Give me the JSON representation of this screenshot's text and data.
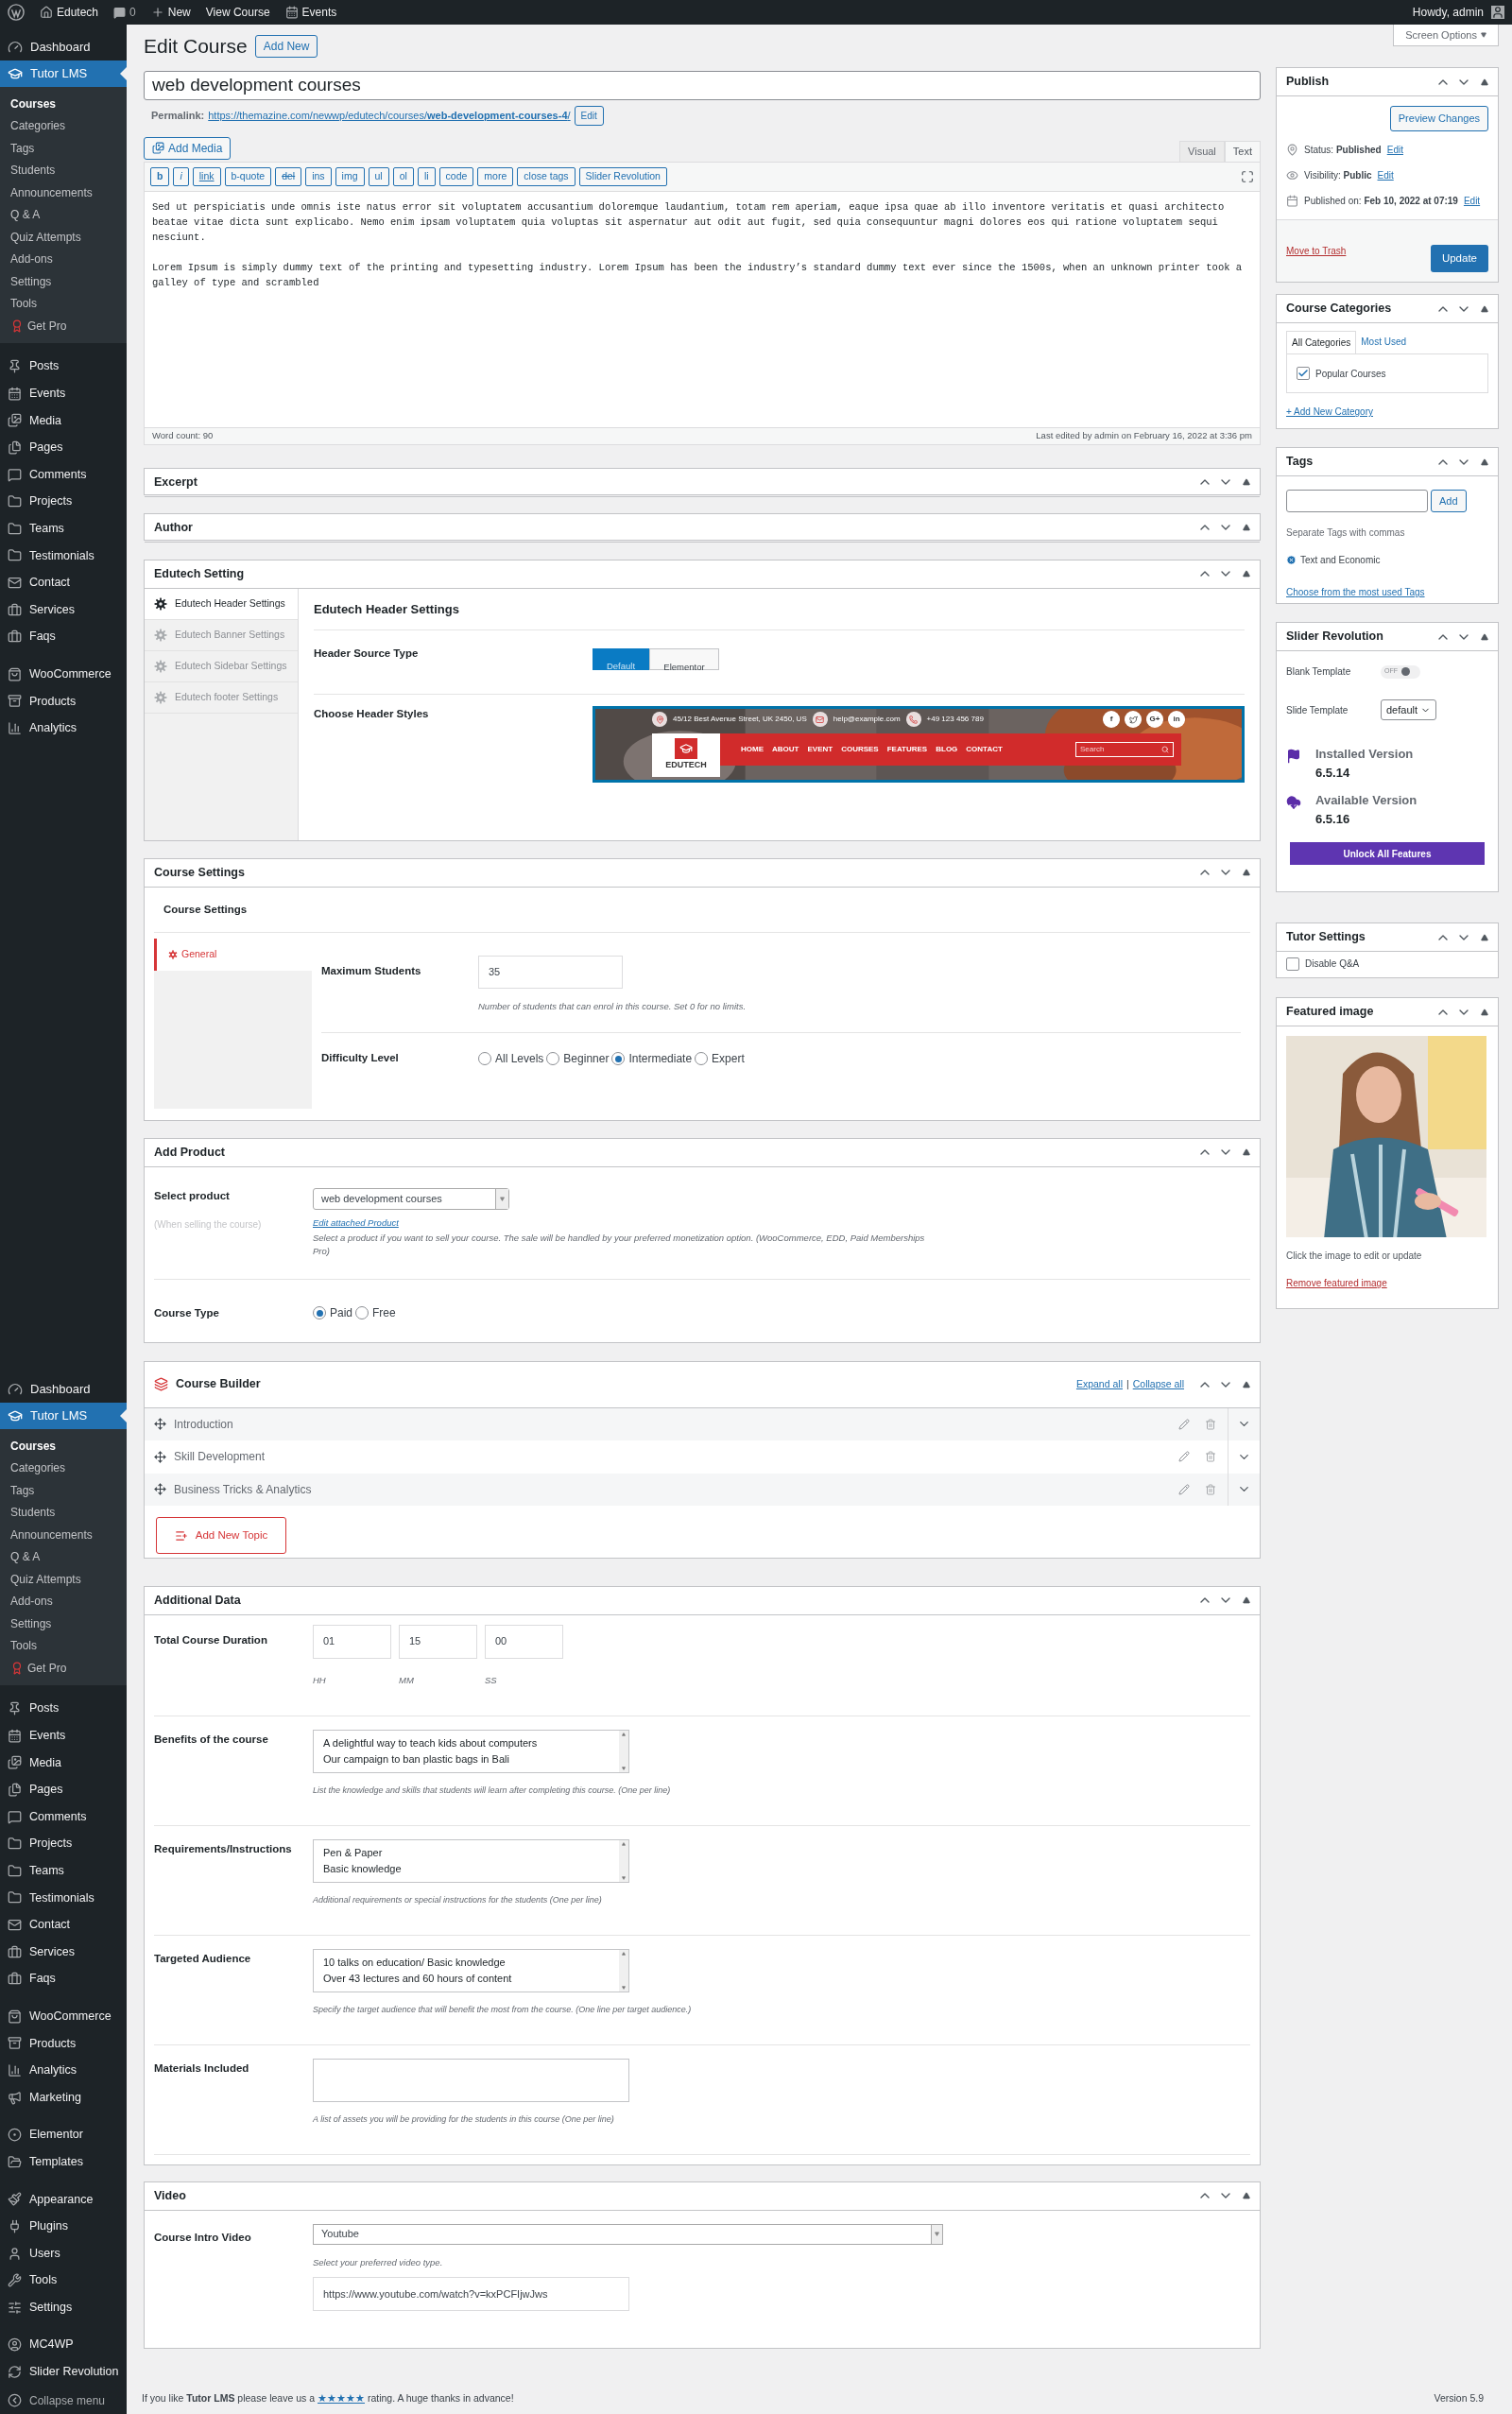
{
  "top_bar": {
    "site": "Edutech",
    "comments": "0",
    "new": "New",
    "view": "View Course",
    "events": "Events",
    "greeting": "Howdy, admin"
  },
  "admin_menus": [
    {
      "heads": [
        {
          "label": "Dashboard",
          "selected": false
        },
        {
          "label": "Tutor LMS",
          "selected": true
        }
      ],
      "submenu": [
        {
          "label": "Courses",
          "current": true,
          "kind": "link"
        },
        {
          "label": "Categories",
          "current": false,
          "kind": "link"
        },
        {
          "label": "Tags",
          "current": false,
          "kind": "link"
        },
        {
          "label": "Students",
          "current": false,
          "kind": "link"
        },
        {
          "label": "Announcements",
          "current": false,
          "kind": "link"
        },
        {
          "label": "Q & A",
          "current": false,
          "kind": "link"
        },
        {
          "label": "Quiz Attempts",
          "current": false,
          "kind": "link"
        },
        {
          "label": "Add-ons",
          "current": false,
          "kind": "link"
        },
        {
          "label": "Settings",
          "current": false,
          "kind": "link"
        },
        {
          "label": "Tools",
          "current": false,
          "kind": "link"
        },
        {
          "label": "Get Pro",
          "current": false,
          "kind": "pro"
        }
      ],
      "groups": [
        [
          "Posts",
          "Events",
          "Media",
          "Pages",
          "Comments",
          "Projects",
          "Teams",
          "Testimonials",
          "Contact",
          "Services",
          "Faqs"
        ],
        [
          "WooCommerce",
          "Products",
          "Analytics"
        ]
      ]
    },
    {
      "heads": [
        {
          "label": "Dashboard",
          "selected": false
        },
        {
          "label": "Tutor LMS",
          "selected": true
        }
      ],
      "submenu": [
        {
          "label": "Courses",
          "current": true,
          "kind": "link"
        },
        {
          "label": "Categories",
          "current": false,
          "kind": "link"
        },
        {
          "label": "Tags",
          "current": false,
          "kind": "link"
        },
        {
          "label": "Students",
          "current": false,
          "kind": "link"
        },
        {
          "label": "Announcements",
          "current": false,
          "kind": "link"
        },
        {
          "label": "Q & A",
          "current": false,
          "kind": "link"
        },
        {
          "label": "Quiz Attempts",
          "current": false,
          "kind": "link"
        },
        {
          "label": "Add-ons",
          "current": false,
          "kind": "link"
        },
        {
          "label": "Settings",
          "current": false,
          "kind": "link"
        },
        {
          "label": "Tools",
          "current": false,
          "kind": "link"
        },
        {
          "label": "Get Pro",
          "current": false,
          "kind": "pro"
        }
      ],
      "groups": [
        [
          "Posts",
          "Events",
          "Media",
          "Pages",
          "Comments",
          "Projects",
          "Teams",
          "Testimonials",
          "Contact",
          "Services",
          "Faqs"
        ],
        [
          "WooCommerce",
          "Products",
          "Analytics",
          "Marketing"
        ],
        [
          "Elementor",
          "Templates"
        ],
        [
          "Appearance",
          "Plugins",
          "Users",
          "Tools",
          "Settings"
        ],
        [
          "MC4WP",
          "Slider Revolution"
        ]
      ],
      "collapse": "Collapse menu"
    }
  ],
  "screen_options": "Screen Options",
  "page": {
    "title": "Edit Course",
    "add_new": "Add New"
  },
  "post_title": "web development courses",
  "permalink": {
    "label": "Permalink:",
    "url": "https://themazine.com/newwp/edutech/courses/**web-development-courses-4**/",
    "edit": "Edit"
  },
  "editor": {
    "add_media": "Add Media",
    "tabs": [
      {
        "label": "Visual",
        "selected": false
      },
      {
        "label": "Text",
        "selected": true
      }
    ],
    "buttons": [
      {
        "label": "b",
        "kind": "bold"
      },
      {
        "label": "i",
        "kind": "italic"
      },
      {
        "label": "link",
        "kind": "link"
      },
      {
        "label": "b-quote",
        "kind": "plain"
      },
      {
        "label": "del",
        "kind": "strike"
      },
      {
        "label": "ins",
        "kind": "plain"
      },
      {
        "label": "img",
        "kind": "plain"
      },
      {
        "label": "ul",
        "kind": "plain"
      },
      {
        "label": "ol",
        "kind": "plain"
      },
      {
        "label": "li",
        "kind": "plain"
      },
      {
        "label": "code",
        "kind": "plain"
      },
      {
        "label": "more",
        "kind": "plain"
      },
      {
        "label": "close tags",
        "kind": "plain"
      },
      {
        "label": "Slider Revolution",
        "kind": "plain"
      }
    ],
    "paragraphs": [
      "Sed ut perspiciatis unde omnis iste natus error sit voluptatem accusantium doloremque laudantium, totam rem aperiam, eaque ipsa quae ab illo inventore veritatis et quasi architecto beatae vitae dicta sunt explicabo. Nemo enim ipsam voluptatem quia voluptas sit aspernatur aut odit aut fugit, sed quia consequuntur magni dolores eos qui ratione voluptatem sequi nesciunt.",
      "Lorem Ipsum is simply dummy text of the printing and typesetting industry. Lorem Ipsum has been the industry’s standard dummy text ever since the 1500s, when an unknown printer took a galley of type and scrambled"
    ],
    "word_count": "Word count: 90",
    "last_edited": "Last edited by admin on February 16, 2022 at 3:36 pm"
  },
  "collapsed_boxes": [
    {
      "title": "Excerpt"
    },
    {
      "title": "Author"
    }
  ],
  "edutech_setting": {
    "title": "Edutech Setting",
    "tabs": [
      {
        "label": "Edutech Header Settings",
        "selected": true
      },
      {
        "label": "Edutech Banner Settings",
        "selected": false
      },
      {
        "label": "Edutech Sidebar Settings",
        "selected": false
      },
      {
        "label": "Edutech footer Settings",
        "selected": false
      }
    ],
    "heading": "Edutech Header Settings",
    "source_type": {
      "label": "Header Source Type",
      "options": [
        {
          "label": "Default",
          "selected": true
        },
        {
          "label": "Elementor",
          "selected": false
        }
      ]
    },
    "header_styles": {
      "label": "Choose Header Styles",
      "address": "45/12 Best Avenue Street, UK 2450, US",
      "email": "help@example.com",
      "phone": "+49 123 456 789",
      "socials": [
        "f",
        "G+",
        "in"
      ],
      "logo": "EDUTECH",
      "nav": [
        "HOME",
        "ABOUT",
        "EVENT",
        "COURSES",
        "FEATURES",
        "BLOG",
        "CONTACT"
      ],
      "search_placeholder": "Search"
    }
  },
  "course_settings": {
    "title": "Course Settings",
    "heading": "Course Settings",
    "tabs": [
      {
        "label": "General",
        "selected": true
      }
    ],
    "max_students": {
      "label": "Maximum Students",
      "value": "35",
      "help": "Number of students that can enrol in this course. Set 0 for no limits."
    },
    "difficulty": {
      "label": "Difficulty Level",
      "options": [
        {
          "label": "All Levels",
          "selected": false
        },
        {
          "label": "Beginner",
          "selected": false
        },
        {
          "label": "Intermediate",
          "selected": true
        },
        {
          "label": "Expert",
          "selected": false
        }
      ]
    }
  },
  "add_product": {
    "title": "Add Product",
    "select_label": "Select product",
    "select_note": "(When selling the course)",
    "select_value": "web development courses",
    "edit_link": "Edit attached Product",
    "help": "Select a product if you want to sell your course. The sale will be handled by your preferred monetization option. (WooCommerce, EDD, Paid Memberships Pro)",
    "course_type": {
      "label": "Course Type",
      "options": [
        {
          "label": "Paid",
          "selected": true
        },
        {
          "label": "Free",
          "selected": false
        }
      ]
    }
  },
  "course_builder": {
    "title": "Course Builder",
    "expand_all": "Expand all",
    "separator": "|",
    "collapse_all": "Collapse all",
    "topics": [
      {
        "title": "Introduction"
      },
      {
        "title": "Skill Development"
      },
      {
        "title": "Business Tricks & Analytics"
      }
    ],
    "add_topic": "Add New Topic"
  },
  "additional_data": {
    "title": "Additional Data",
    "duration": {
      "label": "Total Course Duration",
      "fields": [
        {
          "value": "01",
          "unit": "HH"
        },
        {
          "value": "15",
          "unit": "MM"
        },
        {
          "value": "00",
          "unit": "SS"
        }
      ]
    },
    "textareas": [
      {
        "label": "Benefits of the course",
        "lines": [
          "A delightful way to teach kids about computers",
          "Our campaign to ban plastic bags in Bali"
        ],
        "help": "List the knowledge and skills that students will learn after completing this course. (One per line)"
      },
      {
        "label": "Requirements/Instructions",
        "lines": [
          "Pen & Paper",
          "Basic knowledge"
        ],
        "help": "Additional requirements or special instructions for the students (One per line)"
      },
      {
        "label": "Targeted Audience",
        "lines": [
          "10 talks on education/ Basic knowledge",
          "Over 43 lectures and 60 hours of content"
        ],
        "help": "Specify the target audience that will benefit the most from the course. (One line per target audience.)"
      },
      {
        "label": "Materials Included",
        "help": "A list of assets you will be providing for the students in this course (One per line)"
      }
    ]
  },
  "video": {
    "title": "Video",
    "label": "Course Intro Video",
    "select_value": "Youtube",
    "help": "Select your preferred video type.",
    "url": "https://www.youtube.com/watch?v=kxPCFIjwJws"
  },
  "footer": {
    "thanks": "If you like **Tutor LMS** please leave us a",
    "stars": "★★★★★",
    "after": "rating. A huge thanks in advance!",
    "version": "Version 5.9"
  },
  "publish": {
    "title": "Publish",
    "preview": "Preview Changes",
    "rows": [
      {
        "label": "Status:",
        "value": "Published",
        "edit": "Edit"
      },
      {
        "label": "Visibility:",
        "value": "Public",
        "edit": "Edit"
      },
      {
        "label": "Published on:",
        "value": "Feb 10, 2022 at 07:19",
        "edit": "Edit"
      }
    ],
    "trash": "Move to Trash",
    "update": "Update"
  },
  "course_categories": {
    "title": "Course Categories",
    "tabs": [
      {
        "label": "All Categories",
        "selected": true
      },
      {
        "label": "Most Used",
        "selected": false
      }
    ],
    "items": [
      {
        "label": "Popular Courses",
        "checked": true
      }
    ],
    "add_link": "+ Add New Category"
  },
  "tags": {
    "title": "Tags",
    "add": "Add",
    "hint": "Separate Tags with commas",
    "items": [
      "Text and Economic"
    ],
    "choose_link": "Choose from the most used Tags"
  },
  "slider_revolution": {
    "title": "Slider Revolution",
    "blank_template": {
      "label": "Blank Template",
      "state_text": "OFF",
      "on": false
    },
    "slide_template": {
      "label": "Slide Template",
      "value": "default"
    },
    "installed": {
      "label": "Installed Version",
      "value": "6.5.14"
    },
    "available": {
      "label": "Available Version",
      "value": "6.5.16"
    },
    "unlock": "Unlock All Features"
  },
  "tutor_settings": {
    "title": "Tutor Settings",
    "items": [
      {
        "label": "Disable Q&A",
        "checked": false
      }
    ]
  },
  "featured_image": {
    "title": "Featured image",
    "hint": "Click the image to edit or update",
    "remove": "Remove featured image"
  }
}
